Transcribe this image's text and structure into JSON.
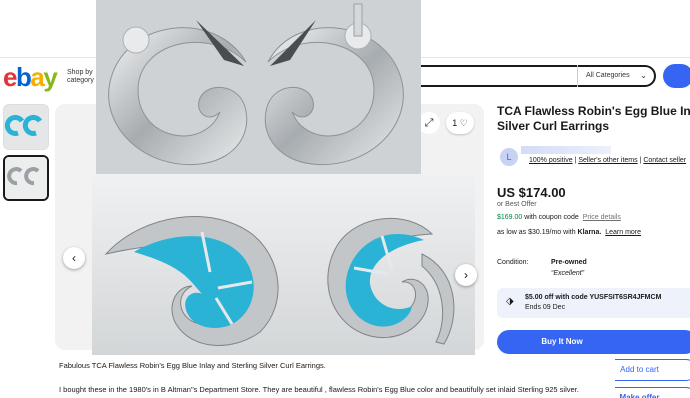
{
  "header": {
    "logo_letters": [
      "e",
      "b",
      "a",
      "y"
    ],
    "logo_colors": [
      "#e53238",
      "#0064d2",
      "#f5af02",
      "#86b817"
    ],
    "shop_by_line1": "Shop by",
    "shop_by_line2": "category",
    "category_select": "All Categories"
  },
  "gallery": {
    "watch_count": "1"
  },
  "listing": {
    "title_line1": "TCA  Flawless Robin's Egg Blue Inlay a",
    "title_line2": "Silver Curl Earrings",
    "seller_avatar_letter": "L",
    "seller_feedback": "100% positive",
    "seller_other_items": "Seller's other items",
    "seller_contact": "Contact seller",
    "price": "US $174.00",
    "best_offer": "or Best Offer",
    "coupon_price": "$169.00",
    "coupon_text": " with coupon code",
    "price_details": "Price details",
    "klarna_prefix": "as low as $30.19/mo with ",
    "klarna_brand": "Klarna.",
    "learn_more": "Learn more",
    "condition_label": "Condition:",
    "condition_value": "Pre-owned",
    "condition_quote": "“Excellent”",
    "offer_line1": "$5.00 off with code YUSFSIT6SR4JFMCM",
    "offer_line2": "Ends 09 Dec",
    "buy_now": "Buy It Now",
    "add_to_cart": "Add to cart",
    "make_offer": "Make offer"
  },
  "caption": {
    "line1": "Fabulous TCA Flawless Robin's Egg Blue Inlay and Sterling Silver Curl Earrings.",
    "line2": "I bought these in the 1980's in B Altman\"s Department Store. They are beautiful , flawless Robin's Egg Blue color and  beautifully set inlaid Sterling 925 silver."
  },
  "colors": {
    "accent": "#3665f3",
    "turquoise": "#2bb3d6",
    "silver": "#b8bcc0",
    "coupon_green": "#05823f"
  }
}
